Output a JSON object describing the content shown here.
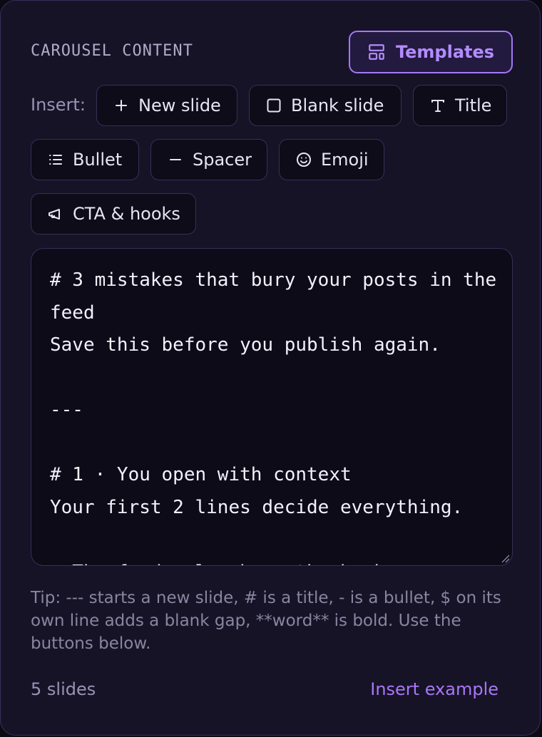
{
  "section_title": "CAROUSEL CONTENT",
  "templates_button": {
    "label": "Templates",
    "icon": "layout-template-icon"
  },
  "insert_label": "Insert:",
  "insert_buttons": [
    {
      "label": "New slide",
      "icon": "plus-icon"
    },
    {
      "label": "Blank slide",
      "icon": "square-icon"
    },
    {
      "label": "Title",
      "icon": "type-icon"
    },
    {
      "label": "Bullet",
      "icon": "list-icon"
    },
    {
      "label": "Spacer",
      "icon": "minus-icon"
    },
    {
      "label": "Emoji",
      "icon": "smile-icon"
    },
    {
      "label": "CTA & hooks",
      "icon": "megaphone-icon"
    }
  ],
  "editor": {
    "value": "# 3 mistakes that bury your posts in the feed\nSave this before you publish again.\n\n---\n\n# 1 · You open with context\nYour first 2 lines decide everything.\n\n- The feed only shows the hook"
  },
  "tip": "Tip: --- starts a new slide, # is a title, - is a bullet, $ on its own line adds a blank gap, **word** is bold. Use the buttons below.",
  "footer": {
    "slide_count": "5 slides",
    "insert_example": "Insert example"
  },
  "colors": {
    "accent": "#a478f7",
    "panel_bg": "#161327",
    "editor_bg": "#0d0b18",
    "border": "#353057"
  }
}
